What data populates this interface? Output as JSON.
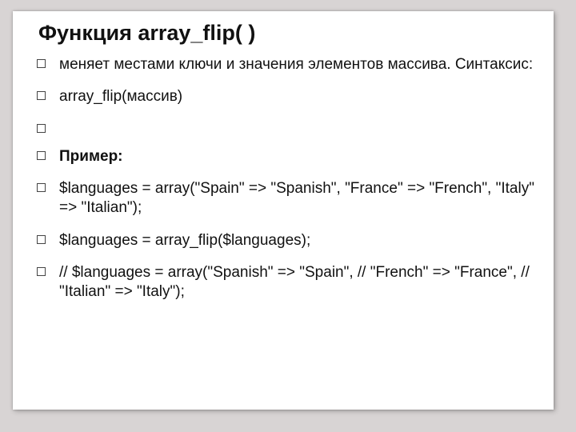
{
  "slide": {
    "title": "Функция array_flip( )",
    "items": [
      {
        "text": "меняет местами ключи и значения элементов массива. Синтаксис:",
        "bold": false
      },
      {
        "text": "array_flip(массив)",
        "bold": false
      },
      {
        "text": "",
        "bold": false
      },
      {
        "text": "Пример:",
        "bold": true
      },
      {
        "text": "$languages = array(\"Spain\" => \"Spanish\", \"France\" => \"French\", \"Italy\" => \"Italian\");",
        "bold": false
      },
      {
        "text": "$languages = array_flip($languages);",
        "bold": false
      },
      {
        "text": "// $languages = array(\"Spanish\" => \"Spain\", // \"French\" => \"France\", // \"Italian\" => \"Italy\");",
        "bold": false
      }
    ]
  }
}
